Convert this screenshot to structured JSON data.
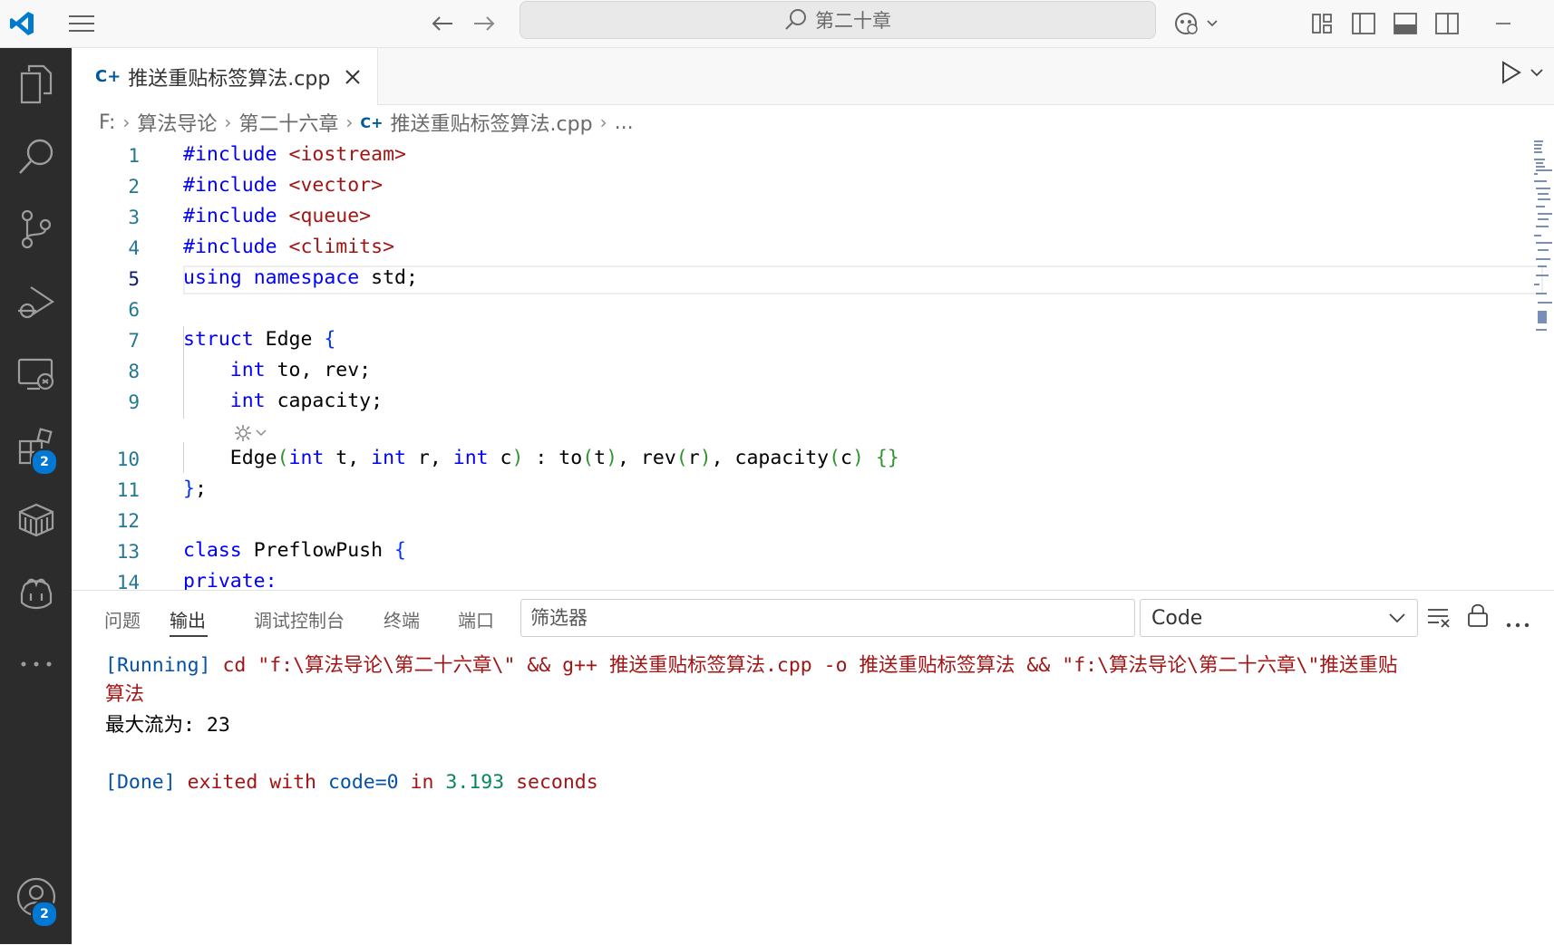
{
  "title_bar": {
    "search_text": "第二十章"
  },
  "tab": {
    "label": "推送重贴标签算法.cpp"
  },
  "breadcrumb": [
    "F:",
    "算法导论",
    "第二十六章",
    "推送重贴标签算法.cpp",
    "..."
  ],
  "activity_bar": {
    "extensions_badge": "2",
    "accounts_badge": "2"
  },
  "editor": {
    "line_numbers": [
      "1",
      "2",
      "3",
      "4",
      "5",
      "6",
      "7",
      "8",
      "9",
      "10",
      "11",
      "12",
      "13",
      "14"
    ],
    "lines": {
      "l1_kw": "#include",
      "l1_inc": "<iostream>",
      "l2_kw": "#include",
      "l2_inc": "<vector>",
      "l3_kw": "#include",
      "l3_inc": "<queue>",
      "l4_kw": "#include",
      "l4_inc": "<climits>",
      "l5_kw1": "using",
      "l5_kw2": "namespace",
      "l5_rest": "std;",
      "l7_kw": "struct",
      "l7_name": "Edge",
      "l7_brace": "{",
      "l8_kw": "int",
      "l8_rest": "to, rev;",
      "l9_kw": "int",
      "l9_rest": "capacity;",
      "l10_name": "Edge",
      "l10_kw": "int",
      "l11_brace": "}",
      "l11_semi": ";",
      "l13_kw": "class",
      "l13_name": "PreflowPush",
      "l13_brace": "{",
      "l14_kw": "private:"
    }
  },
  "panel": {
    "tabs": [
      "问题",
      "输出",
      "调试控制台",
      "终端",
      "端口"
    ],
    "filter_placeholder": "筛选器",
    "output_channel": "Code",
    "output": {
      "running_tag": "[Running]",
      "running_cmd": " cd \"f:\\算法导论\\第二十六章\\\" && g++ 推送重贴标签算法.cpp -o 推送重贴标签算法 && \"f:\\算法导论\\第二十六章\\\"推送重贴",
      "running_wrap": "算法",
      "result": "最大流为: 23",
      "done_tag": "[Done]",
      "done_a": " exited with ",
      "done_code": "code=0",
      "done_b": " in ",
      "done_time": "3.193",
      "done_c": " seconds"
    }
  },
  "colors": {
    "accent": "#0078d4",
    "activity_bg": "#2c2c2c",
    "keyword": "#0000ff",
    "string": "#a31515",
    "line_number": "#237893"
  }
}
